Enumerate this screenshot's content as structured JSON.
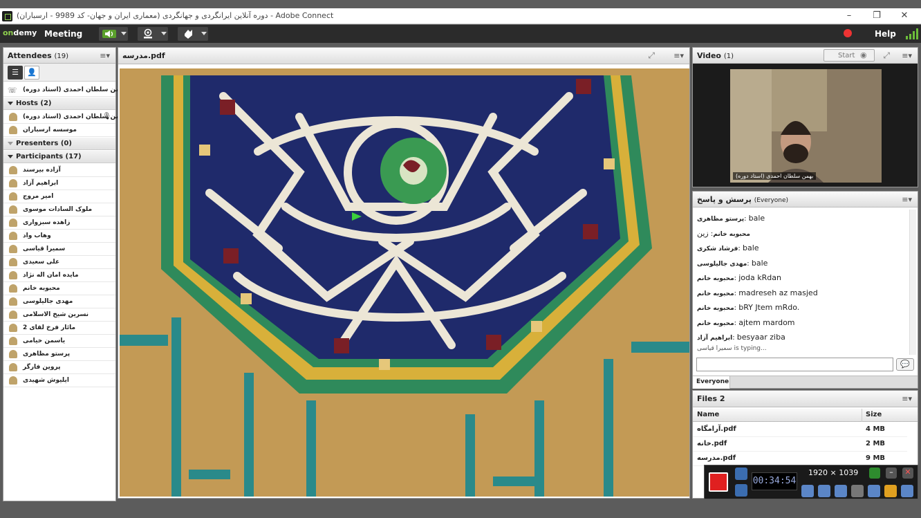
{
  "window": {
    "title": "دوره آنلاین ایرانگردی و جهانگردی (معماری ایران و جهان- کد 9989 - ارسباران) - Adobe Connect",
    "controls": [
      "–",
      "❐",
      "✕"
    ]
  },
  "menubar": {
    "logo_prefix": "on",
    "logo_suffix": "demy",
    "meeting_label": "Meeting",
    "help_label": "Help"
  },
  "attendees": {
    "title": "Attendees",
    "count": "(19)",
    "me": "بهمن سلطان احمدی (استاد دوره)",
    "hosts_label": "Hosts (2)",
    "hosts": [
      "بهمن سلطان احمدی (استاد دوره)",
      "موسسه ارسباران"
    ],
    "presenters_label": "Presenters (0)",
    "participants_label": "Participants (17)",
    "participants": [
      "آزاده بیرسند",
      "ابراهیم آزاد",
      "امیر مروج",
      "ملوک السادات موسوی",
      "زاهده سبزواری",
      "وهاب واد",
      "سمیرا قیاسی",
      "علی سعیدی",
      "مایده امان اله نژاد",
      "محبوبه خانم",
      "مهدی جالیلوسی",
      "نسرین شیخ الاسلامی",
      "مائار فرخ لقای 2",
      "یاسمن خیامی",
      "پرستو مظاهری",
      "پروین فارگر",
      "ایلیوش شهیدی"
    ]
  },
  "share": {
    "title": "مدرسه.pdf"
  },
  "video": {
    "title": "Video",
    "count": "(1)",
    "start_label": "Start",
    "caption": "بهمن سلطان احمدی (استاد دوره)"
  },
  "chat": {
    "title": "پرسش و پاسخ",
    "scope": "(Everyone)",
    "messages": [
      {
        "sender": "پرستو مظاهری",
        "text": "bale"
      },
      {
        "sender": "محبوبه خانم",
        "text": "زین"
      },
      {
        "sender": "فرشاد شکری",
        "text": "bale"
      },
      {
        "sender": "مهدی جالیلوسی",
        "text": "bale"
      },
      {
        "sender": "محبوبه خانم",
        "text": "joda kRdan"
      },
      {
        "sender": "محبوبه خانم",
        "text": "madreseh az masjed"
      },
      {
        "sender": "محبوبه خانم",
        "text": "bRY Jtem mRdo."
      },
      {
        "sender": "محبوبه خانم",
        "text": "ajtem mardom"
      },
      {
        "sender": "ابراهیم آزاد",
        "text": "besyaar ziba"
      }
    ],
    "typing": "سمیرا قیاسی is typing...",
    "audience_tab": "Everyone"
  },
  "files": {
    "title": "Files",
    "count": "2",
    "col_name": "Name",
    "col_size": "Size",
    "rows": [
      {
        "name": "آرامگاه.pdf",
        "size": "4 MB"
      },
      {
        "name": "خانه.pdf",
        "size": "2 MB"
      },
      {
        "name": "مدرسه.pdf",
        "size": "9 MB"
      }
    ]
  },
  "recorder": {
    "timer": "00:34:54",
    "resolution": "1920 × 1039"
  },
  "colors": {
    "accent_green": "#8fd14f",
    "record_red": "#e02020",
    "tile_blue": "#1f2a6b",
    "tile_green": "#2a8a5a",
    "tile_yellow": "#d9b43a"
  }
}
